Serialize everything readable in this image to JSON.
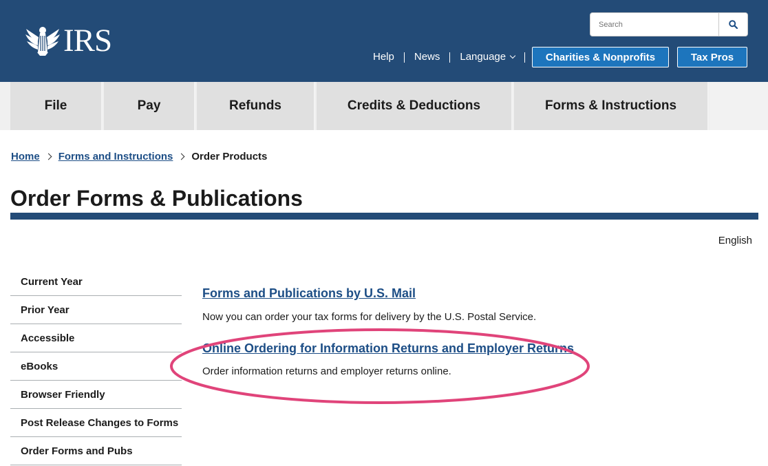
{
  "header": {
    "logo_text": "IRS",
    "search": {
      "placeholder": "Search"
    },
    "utility_links": [
      "Help",
      "News",
      "Language"
    ],
    "buttons": {
      "charities": "Charities & Nonprofits",
      "tax_pros": "Tax Pros"
    }
  },
  "main_nav": [
    "File",
    "Pay",
    "Refunds",
    "Credits & Deductions",
    "Forms & Instructions"
  ],
  "breadcrumb": {
    "home": "Home",
    "forms": "Forms and Instructions",
    "current": "Order Products"
  },
  "page_title": "Order Forms & Publications",
  "language": "English",
  "sidebar": [
    "Current Year",
    "Prior Year",
    "Accessible",
    "eBooks",
    "Browser Friendly",
    "Post Release Changes to Forms",
    "Order Forms and Pubs"
  ],
  "content": [
    {
      "title": "Forms and Publications by U.S. Mail",
      "desc": "Now you can order your tax forms for delivery by the U.S. Postal Service."
    },
    {
      "title": "Online Ordering for Information Returns and Employer Returns",
      "desc": "Order information returns and employer returns online."
    }
  ],
  "colors": {
    "header_bg": "#234b77",
    "link": "#1d4e86",
    "pill_bg": "#1d75bd",
    "highlight": "#e0447a"
  }
}
